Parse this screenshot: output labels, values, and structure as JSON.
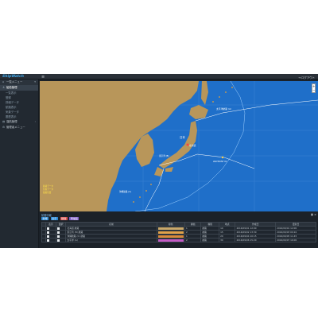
{
  "header": {
    "app_title": "ShipWatch",
    "menu_icon": "hamburger-icon",
    "logout_label": "ログアウト",
    "topbar_color": "#2a3038"
  },
  "sidebar": {
    "menu_title": "一覧メニュー",
    "items": [
      {
        "icon": "ship-icon",
        "label": "船舶管理",
        "active": true
      },
      {
        "icon": "",
        "label": "一覧表示"
      },
      {
        "icon": "",
        "label": "登録"
      },
      {
        "icon": "",
        "label": "詳細データ"
      },
      {
        "icon": "",
        "label": "航路表示"
      },
      {
        "icon": "",
        "label": "気象データ"
      },
      {
        "icon": "",
        "label": "履歴表示"
      },
      {
        "icon": "chart-icon",
        "label": "運航管理"
      },
      {
        "icon": "gear-icon",
        "label": "管理者メニュー"
      }
    ]
  },
  "map": {
    "sea_color": "#1f6fc9",
    "land_color": "#b8965a",
    "labels": {
      "japan": "日本",
      "route_top": "太平洋航路 (A)",
      "route_mid": "東京湾 (B)",
      "route_south": "沖縄航路 (C)",
      "marker": "北海道",
      "marker2": "WAYPOINT 01",
      "legend_1": "航路データ",
      "legend_2": "気象データ",
      "legend_3": "船舶位置"
    },
    "zoom_in": "+",
    "zoom_out": "−"
  },
  "lower_panel": {
    "title": "航路情報",
    "buttons": [
      {
        "label": "新規",
        "color": "#2c8ad6"
      },
      {
        "label": "表示",
        "color": "#2c8ad6"
      },
      {
        "label": "削除",
        "color": "#d9534f"
      },
      {
        "label": "再描画",
        "color": "#7d5cc6"
      }
    ],
    "icons": [
      "expand-icon",
      "close-icon"
    ],
    "columns": [
      "",
      "表示",
      "選択",
      "名前",
      "線色",
      "線幅",
      "種別",
      "地点",
      "作成日",
      "更新日"
    ],
    "rows": [
      {
        "name": "北海道 航路",
        "color": "#c9a86a",
        "width": "1",
        "type": "航路",
        "points": "10",
        "created": "2016/09/01 12:00",
        "updated": "2016/09/01 12:00"
      },
      {
        "name": "東京湾 (B) 航路",
        "color": "#e0a24a",
        "width": "2",
        "type": "航路",
        "points": "15",
        "created": "2016/09/02 13:30",
        "updated": "2016/09/03 09:10"
      },
      {
        "name": "沖縄航路 (C) 航路",
        "color": "#d98a3a",
        "width": "1",
        "type": "航路",
        "points": "20",
        "created": "2016/09/04 10:15",
        "updated": "2016/09/05 11:45"
      },
      {
        "name": "太平洋 (A)",
        "color": "#c45cc6",
        "width": "2",
        "type": "航路",
        "points": "30",
        "created": "2016/09/06 15:20",
        "updated": "2016/09/07 16:00"
      }
    ]
  }
}
